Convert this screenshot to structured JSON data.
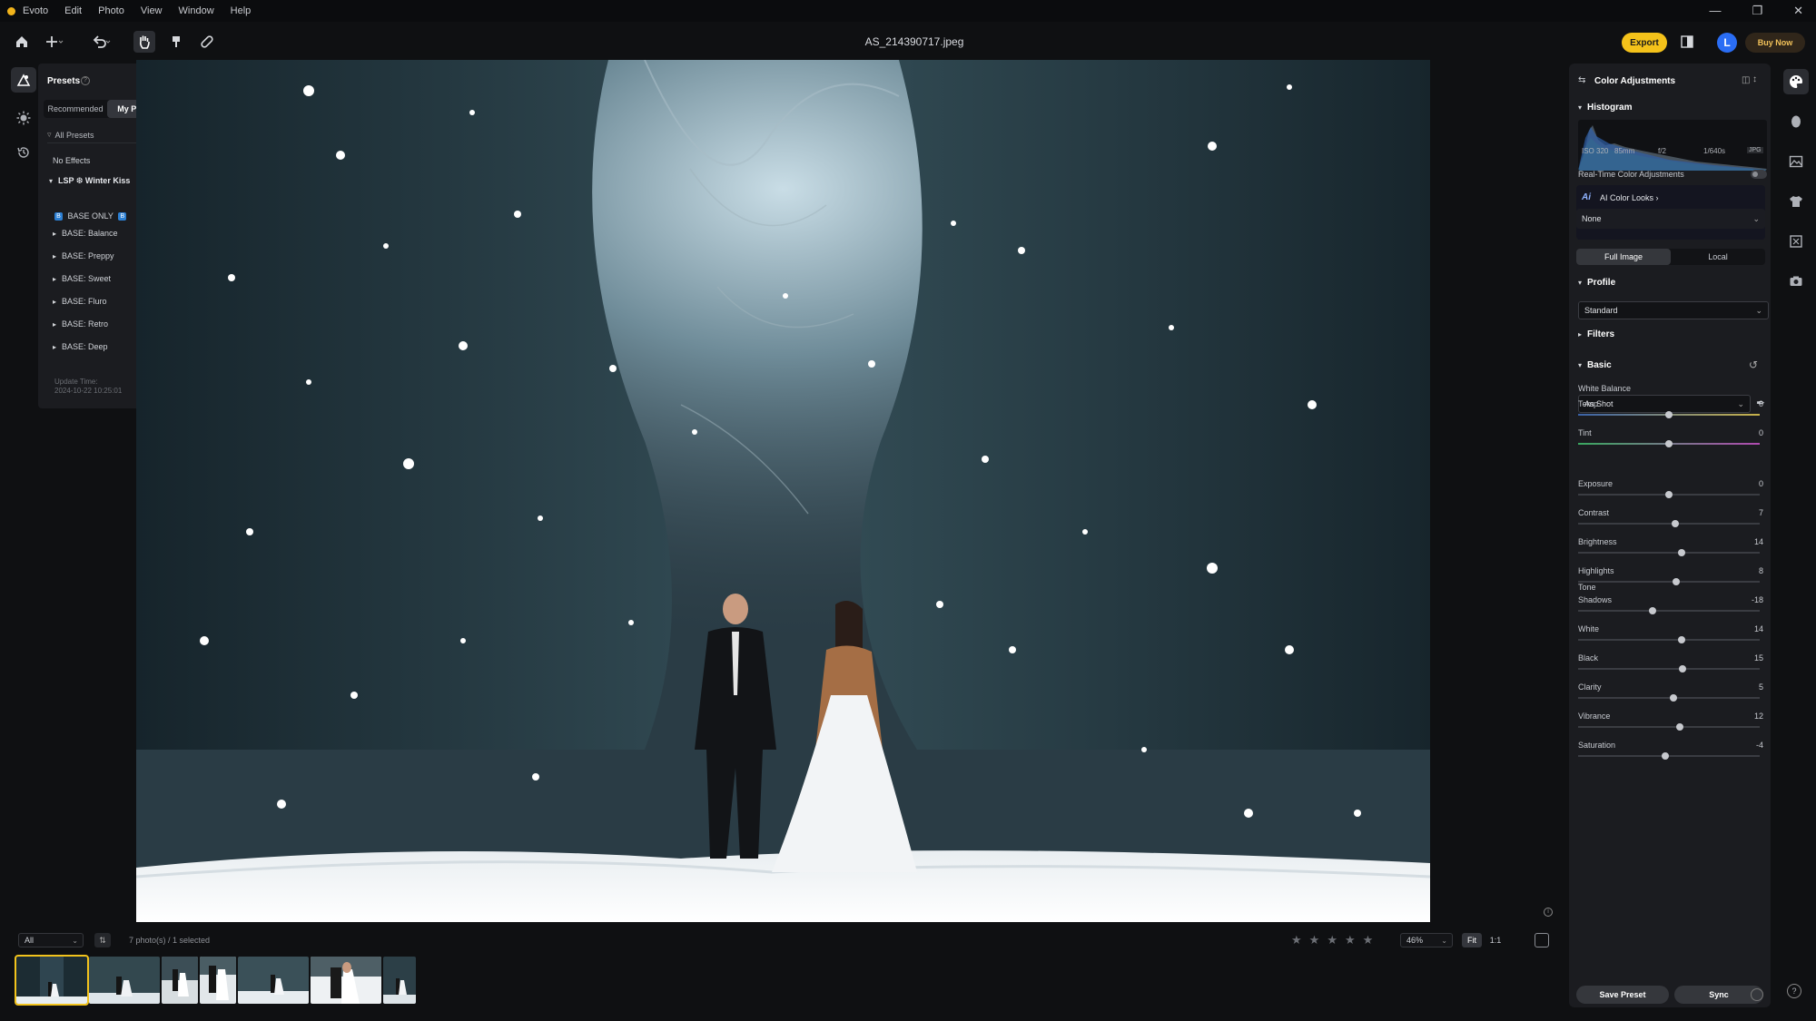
{
  "menubar": {
    "app_name": "Evoto",
    "items": [
      "Edit",
      "Photo",
      "View",
      "Window",
      "Help"
    ]
  },
  "toolbar": {
    "file_name": "AS_214390717.jpeg",
    "export_label": "Export",
    "avatar_initial": "L",
    "buy_label": "Buy Now"
  },
  "presets": {
    "title": "Presets",
    "tabs": [
      "Recommended",
      "My Presets"
    ],
    "active_tab": "My Presets",
    "filter": "All Presets",
    "no_effects": "No Effects",
    "group_name": "LSP ❆ Winter Kiss",
    "base_only": "BASE ONLY",
    "items": [
      "BASE: Balance",
      "BASE: Preppy",
      "BASE: Sweet",
      "BASE: Fluro",
      "BASE: Retro",
      "BASE: Deep"
    ],
    "update_label": "Update Time:",
    "update_time": "2024-10-22 10:25:01"
  },
  "panel": {
    "title": "Color Adjustments",
    "histogram_title": "Histogram",
    "exif": {
      "iso": "ISO 320",
      "focal": "85mm",
      "aperture": "f/2",
      "shutter": "1/640s",
      "format": "JPG"
    },
    "realtime_label": "Real-Time Color Adjustments",
    "ai_looks_label": "AI Color Looks",
    "ai_looks_value": "None",
    "scope_tabs": [
      "Full Image",
      "Local"
    ],
    "scope_active": "Full Image",
    "profile_title": "Profile",
    "profile_value": "Standard",
    "filters_title": "Filters",
    "basic_title": "Basic",
    "white_balance_label": "White Balance",
    "white_balance_value": "As Shot",
    "tone_label": "Tone",
    "sliders": [
      {
        "label": "Temp",
        "value": "0",
        "level": 0.5
      },
      {
        "label": "Tint",
        "value": "0",
        "level": 0.5
      },
      {
        "label": "Exposure",
        "value": "0",
        "level": 0.5
      },
      {
        "label": "Contrast",
        "value": "7",
        "level": 0.535
      },
      {
        "label": "Brightness",
        "value": "14",
        "level": 0.57
      },
      {
        "label": "Highlights",
        "value": "8",
        "level": 0.54
      },
      {
        "label": "Shadows",
        "value": "-18",
        "level": 0.41
      },
      {
        "label": "White",
        "value": "14",
        "level": 0.57
      },
      {
        "label": "Black",
        "value": "15",
        "level": 0.575
      },
      {
        "label": "Clarity",
        "value": "5",
        "level": 0.525
      },
      {
        "label": "Vibrance",
        "value": "12",
        "level": 0.56
      },
      {
        "label": "Saturation",
        "value": "-4",
        "level": 0.48
      }
    ],
    "save_preset_label": "Save Preset",
    "sync_label": "Sync"
  },
  "bottom": {
    "filter_value": "All",
    "count_label": "7 photo(s) / 1 selected",
    "zoom_value": "46%",
    "fit_label": "Fit",
    "one_to_one_label": "1:1"
  },
  "colors": {
    "accent": "#f4c21a",
    "avatar": "#2a6df4",
    "panel_bg": "#1b1c20"
  }
}
